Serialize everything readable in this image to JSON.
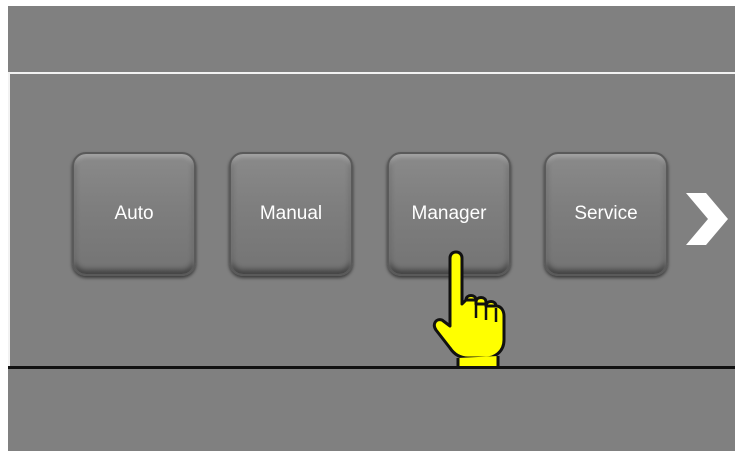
{
  "colors": {
    "background": "#808080",
    "divider_light": "#f2f2f2",
    "divider_dark": "#111111",
    "button_text": "#ffffff",
    "pointer_fill": "#ffff00"
  },
  "mode_buttons": [
    {
      "label": "Auto"
    },
    {
      "label": "Manual"
    },
    {
      "label": "Manager"
    },
    {
      "label": "Service"
    }
  ],
  "icons": {
    "next": "chevron-right-icon",
    "pointer": "hand-pointer-icon"
  },
  "highlighted_button": "Manager"
}
